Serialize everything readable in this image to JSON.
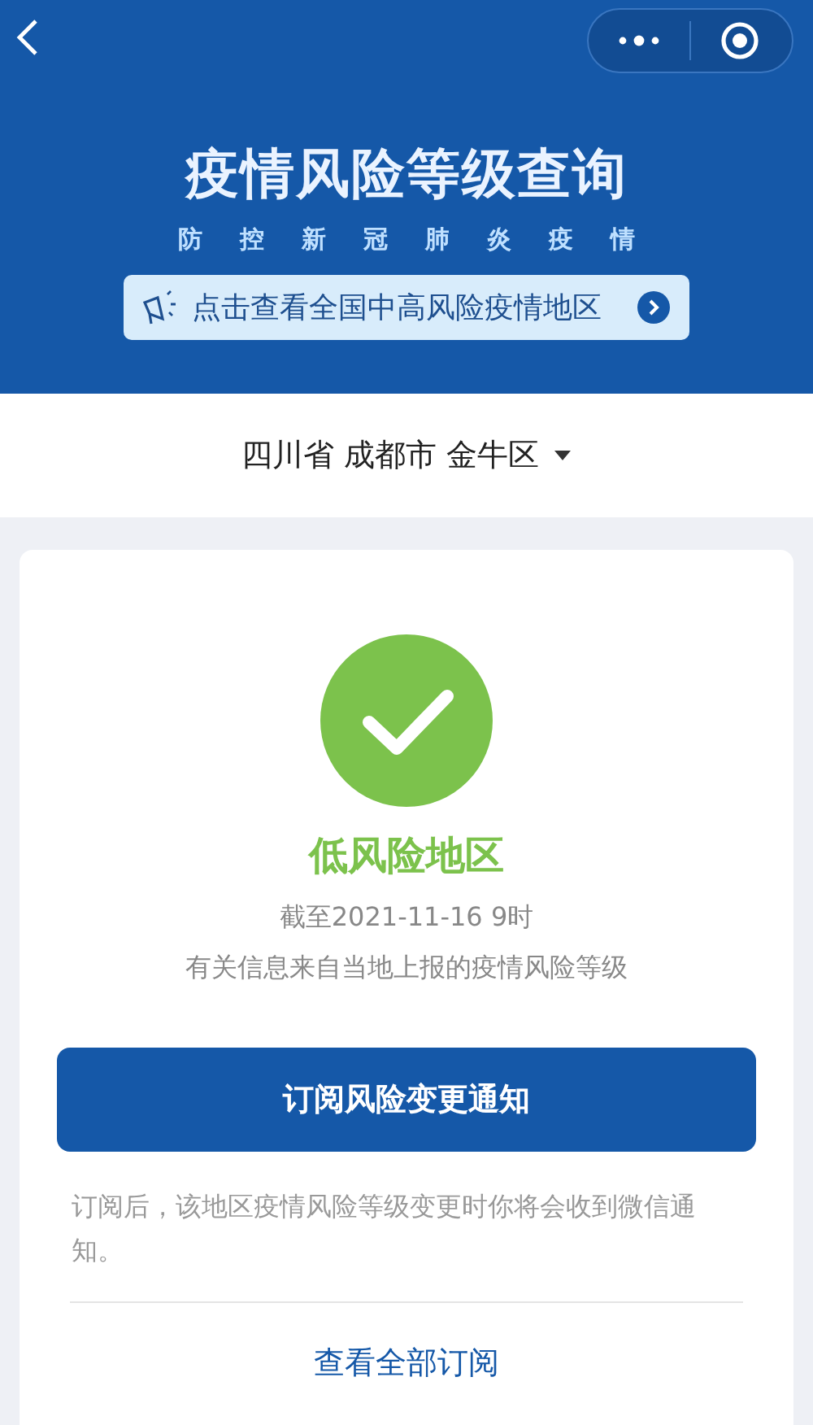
{
  "header": {
    "title": "疫情风险等级查询",
    "subtitle": "防控新冠肺炎疫情",
    "notice_link": "点击查看全国中高风险疫情地区"
  },
  "region_selector": {
    "label": "四川省 成都市 金牛区"
  },
  "result": {
    "kind": "low",
    "label": "低风险地区",
    "as_of": "截至2021-11-16 9时",
    "source_note": "有关信息来自当地上报的疫情风险等级"
  },
  "subscribe_button": "订阅风险变更通知",
  "subscribe_note": "订阅后，该地区疫情风险等级变更时你将会收到微信通知。",
  "view_all_link": "查看全部订阅"
}
